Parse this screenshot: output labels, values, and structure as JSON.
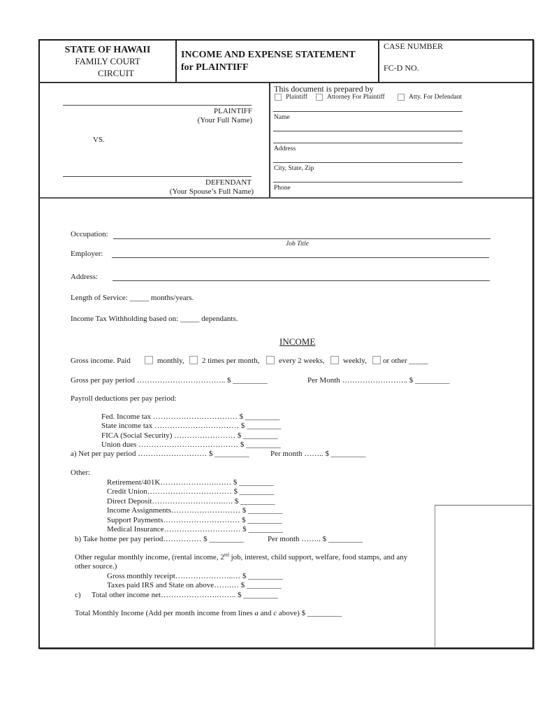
{
  "header": {
    "court_state": "STATE OF HAWAII",
    "court_name": "FAMILY COURT",
    "circuit": "CIRCUIT",
    "title_line1": "INCOME AND EXPENSE STATEMENT",
    "title_line2": "for PLAINTIFF",
    "case_number_label": "CASE NUMBER",
    "fcd_label": "FC-D NO."
  },
  "parties": {
    "plaintiff_label": "PLAINTIFF",
    "plaintiff_hint": "(Your Full Name)",
    "vs_label": "VS.",
    "defendant_label": "DEFENDANT",
    "defendant_hint": "(Your Spouse’s Full Name)"
  },
  "prepared_by": {
    "heading": "This document is prepared by",
    "options": [
      "Plaintiff",
      "Attorney For Plaintiff",
      "Atty. For Defendant"
    ],
    "fields": {
      "name": "Name",
      "address": "Address",
      "city_state_zip": "City, State, Zip",
      "phone": "Phone"
    }
  },
  "employment": {
    "occupation_label": "Occupation:",
    "job_title_hint": "Job Title",
    "employer_label": "Employer:",
    "address_label": "Address:",
    "length_prefix": "Length of Service:",
    "length_blank": "_____",
    "length_suffix": "months/years.",
    "withholding_prefix": "Income Tax Withholding based on:",
    "withholding_blank": "_____",
    "withholding_suffix": "dependants."
  },
  "income": {
    "section_title": "INCOME",
    "gross_paid_label": "Gross income.  Paid",
    "pay_frequencies": [
      "monthly,",
      "2 times per month,",
      "every 2 weeks,",
      "weekly,",
      "or other _____"
    ],
    "gross_per_pay_period": "Gross per pay period …………………………….. $ _________",
    "gross_per_month": "Per Month …………………….. $ _________",
    "payroll_deductions_label": "Payroll deductions per pay period:",
    "deductions": [
      "Fed. Income tax ……………………………   $ _________",
      "State income tax ……………………………  $ _________",
      "FICA (Social Security) ……………………   $ _________",
      "Union dues …………………………………  $ _________"
    ],
    "net_per_pay_period": "a) Net per pay period ………………………  $ _________",
    "net_per_month": "Per month ……..  $ _________",
    "other_label": "Other:",
    "other_deductions": [
      "Retirement/401K………………….……   $ _________",
      "Credit Union……………………………   $ _________",
      "Direct Deposit……………………….….   $ _________",
      "Income Assignments………………………   $ _________",
      "Support Payments…………………………   $ _________",
      "Medical Insurance…………………………   $ _________"
    ],
    "take_home_per_pay_period": "b)  Take home per pay period……………  $ _________",
    "take_home_per_month": "Per month ……..  $ _________",
    "other_regular_line1_a": "Other regular monthly income, (rental income, 2",
    "other_regular_sup": "nd",
    "other_regular_line1_b": " job, interest, child support, welfare, food stamps, and any",
    "other_regular_line2": "other source.)",
    "gross_monthly_receipt": "Gross monthly receipt…………………..…   $ _________",
    "taxes_paid": "Taxes paid IRS and State on above…….…   $ _________",
    "total_other_label": "c)",
    "total_other_net": "Total other income net………………….……..   $ _________",
    "total_monthly_prefix": "Total Monthly Income (Add per month income from lines ",
    "total_monthly_a": "a",
    "total_monthly_and": " and ",
    "total_monthly_c": "c",
    "total_monthly_suffix": " above)  $ _________"
  }
}
